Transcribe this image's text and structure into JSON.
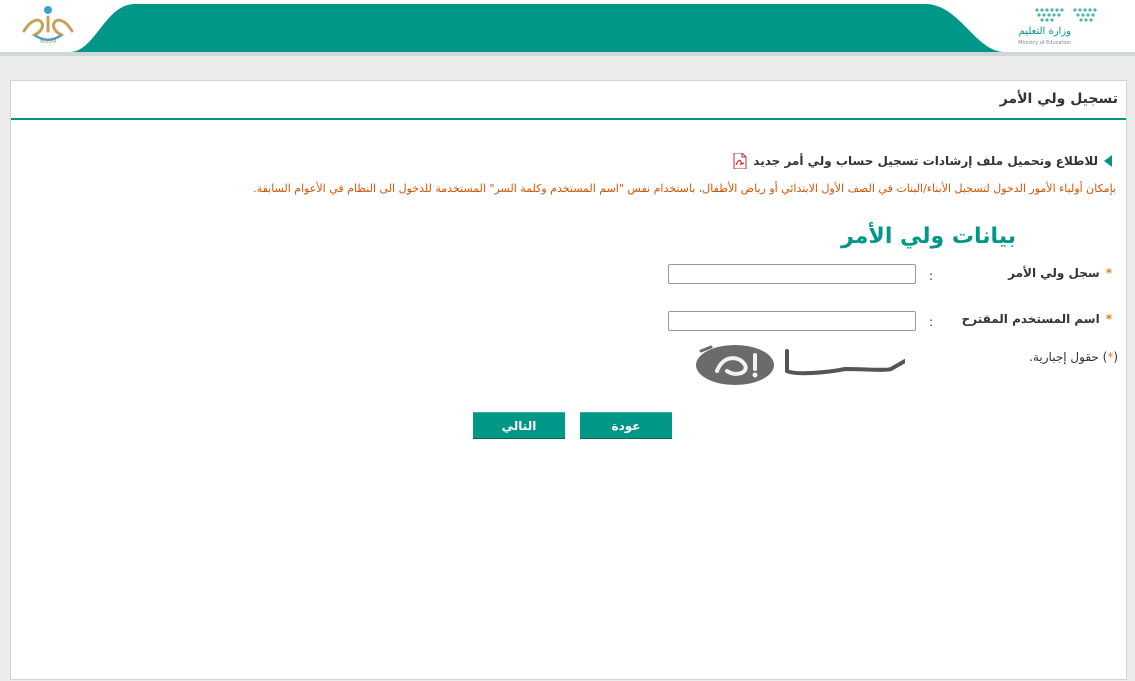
{
  "header": {
    "ministry_name_ar": "وزارة التعليم",
    "ministry_name_en": "Ministry of Education",
    "noor_label": "NOOR",
    "accent_color": "#009688"
  },
  "page": {
    "title": "تسجيل ولي الأمر"
  },
  "guide": {
    "link_text": "للاطلاع وتحميل ملف إرشادات تسجيل حساب ولي أمر جديد",
    "icon": "pdf-icon"
  },
  "notice": "بإمكان أولياء الأمور الدخول لتسجيل الأبناء/البنات في الصف الأول الابتدائي أو رياض الأطفال، باستخدام نفس \"اسم المستخدم وكلمة السر\" المستخدمة للدخول الى النظام في الأعوام السابقة.",
  "form": {
    "section_title": "بيانات ولي الأمر",
    "fields": [
      {
        "label": "سجل ولي الأمر",
        "required_mark": "*",
        "separator": ":",
        "value": ""
      },
      {
        "label": "اسم المستخدم المقترح",
        "required_mark": "*",
        "separator": ":",
        "value": ""
      }
    ],
    "mandatory_note_prefix": "(",
    "mandatory_note_star": "*",
    "mandatory_note_text": ") حقول إجبارية."
  },
  "buttons": {
    "back": "عودة",
    "next": "التالي"
  }
}
